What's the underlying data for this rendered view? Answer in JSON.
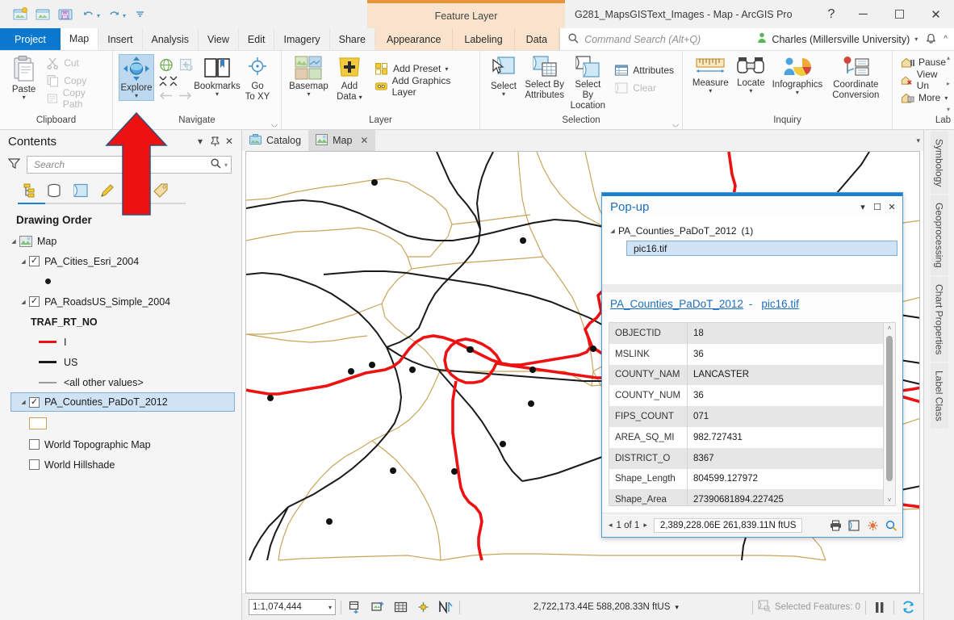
{
  "window": {
    "title": "G281_MapsGISText_Images - Map - ArcGIS Pro",
    "help_label": "?",
    "minimize_label": "─",
    "maximize_label": "☐",
    "close_label": "✕"
  },
  "quick_access": {
    "items": [
      {
        "name": "new-project-icon",
        "title": "New Project"
      },
      {
        "name": "open-project-icon",
        "title": "Open Project"
      },
      {
        "name": "save-project-icon",
        "title": "Save Project"
      },
      {
        "name": "undo-icon",
        "title": "Undo"
      },
      {
        "name": "redo-icon",
        "title": "Redo"
      },
      {
        "name": "customize-quick-access-icon",
        "title": "Customize Quick Access Toolbar"
      }
    ]
  },
  "contextual_tab_group": {
    "label": "Feature Layer"
  },
  "ribbon_tabs": [
    {
      "label": "Project",
      "kind": "project"
    },
    {
      "label": "Map",
      "kind": "active"
    },
    {
      "label": "Insert",
      "kind": "normal"
    },
    {
      "label": "Analysis",
      "kind": "normal"
    },
    {
      "label": "View",
      "kind": "normal"
    },
    {
      "label": "Edit",
      "kind": "normal"
    },
    {
      "label": "Imagery",
      "kind": "normal"
    },
    {
      "label": "Share",
      "kind": "normal"
    },
    {
      "label": "Appearance",
      "kind": "ctx"
    },
    {
      "label": "Labeling",
      "kind": "ctx"
    },
    {
      "label": "Data",
      "kind": "ctx"
    }
  ],
  "command_search": {
    "placeholder": "Command Search (Alt+Q)",
    "icon": "search-icon"
  },
  "account": {
    "name": "Charles (Millersville University)",
    "caret": "▾",
    "notification_icon": "bell-icon",
    "collapse_ribbon_icon": "chevron-up-icon"
  },
  "ribbon_groups": [
    {
      "label": "Clipboard",
      "big": [
        {
          "label": "Paste",
          "icon": "paste-icon",
          "has_caret": true
        }
      ],
      "small": [
        {
          "label": "Cut",
          "icon": "cut-icon",
          "disabled": true
        },
        {
          "label": "Copy",
          "icon": "copy-icon",
          "disabled": true
        },
        {
          "label": "Copy Path",
          "icon": "copy-path-icon",
          "disabled": true
        }
      ]
    },
    {
      "label": "Navigate",
      "has_dialog_launcher": true,
      "big": [
        {
          "label": "Explore",
          "icon": "explore-icon",
          "has_caret": true,
          "selected": true
        },
        {
          "label": "Bookmarks",
          "icon": "bookmarks-icon",
          "has_caret": true
        },
        {
          "label": "Go\nTo XY",
          "icon": "go-to-xy-icon",
          "has_caret": false
        }
      ],
      "small": [
        {
          "label": "",
          "icon": "full-extent-icon"
        },
        {
          "label": "",
          "icon": "fixed-zoom-in-icon"
        },
        {
          "label": "",
          "icon": "zoom-to-selection-icon"
        },
        {
          "label": "",
          "icon": "previous-extent-icon"
        },
        {
          "label": "",
          "icon": "next-extent-icon"
        }
      ]
    },
    {
      "label": "Layer",
      "big": [
        {
          "label": "Basemap",
          "icon": "basemap-icon",
          "has_caret": true
        },
        {
          "label": "Add\nData",
          "icon": "add-data-icon",
          "has_caret": true
        }
      ],
      "small": [
        {
          "label": "Add Preset",
          "icon": "add-preset-icon",
          "has_caret": true
        },
        {
          "label": "Add Graphics Layer",
          "icon": "add-graphics-layer-icon"
        }
      ]
    },
    {
      "label": "Selection",
      "has_dialog_launcher": true,
      "big": [
        {
          "label": "Select",
          "icon": "select-icon",
          "has_caret": true
        },
        {
          "label": "Select By\nAttributes",
          "icon": "select-by-attributes-icon"
        },
        {
          "label": "Select By\nLocation",
          "icon": "select-by-location-icon"
        }
      ],
      "small": [
        {
          "label": "Attributes",
          "icon": "attributes-icon"
        },
        {
          "label": "Clear",
          "icon": "clear-selection-icon",
          "disabled": true
        }
      ]
    },
    {
      "label": "Inquiry",
      "big": [
        {
          "label": "Measure",
          "icon": "measure-icon",
          "has_caret": true
        },
        {
          "label": "Locate",
          "icon": "locate-icon",
          "has_caret": true
        },
        {
          "label": "Infographics",
          "icon": "infographics-icon",
          "has_caret": true
        },
        {
          "label": "Coordinate\nConversion",
          "icon": "coordinate-conversion-icon"
        }
      ],
      "small": []
    },
    {
      "label": "Lab",
      "big": [],
      "small": [
        {
          "label": "Pause",
          "icon": "pause-labeling-icon"
        },
        {
          "label": "View Un",
          "icon": "view-unplaced-labels-icon"
        },
        {
          "label": "More",
          "icon": "more-labeling-icon",
          "has_caret": true
        }
      ]
    }
  ],
  "contents_pane": {
    "title": "Contents",
    "menu_icon": "chevron-down-icon",
    "pin_icon": "pin-icon",
    "close_icon": "close-icon",
    "filter_icon": "funnel-icon",
    "search": {
      "placeholder": "Search",
      "value": "",
      "icon": "search-icon",
      "dropdown": "▾"
    },
    "view_tabs": [
      {
        "name": "list-by-drawing-order-icon",
        "active": true
      },
      {
        "name": "list-by-data-source-icon",
        "active": false
      },
      {
        "name": "list-by-selection-icon",
        "active": false
      },
      {
        "name": "list-by-editing-icon",
        "active": false
      },
      {
        "name": "list-by-snapping-icon",
        "active": false
      },
      {
        "name": "list-by-labeling-icon",
        "active": false
      }
    ],
    "section_title": "Drawing Order",
    "tree": [
      {
        "type": "map",
        "label": "Map",
        "indent": 0,
        "expander": true,
        "icon": "map-icon"
      },
      {
        "type": "layer",
        "label": "PA_Cities_Esri_2004",
        "indent": 1,
        "expander": true,
        "checked": true
      },
      {
        "type": "symbol-point",
        "label": "",
        "indent": 2
      },
      {
        "type": "layer",
        "label": "PA_RoadsUS_Simple_2004",
        "indent": 1,
        "expander": true,
        "checked": true
      },
      {
        "type": "field-header",
        "label": "TRAF_RT_NO",
        "indent": 2
      },
      {
        "type": "symbol-line",
        "label": "I",
        "indent": 2,
        "color": "#ee1111",
        "width": 3
      },
      {
        "type": "symbol-line",
        "label": "US",
        "indent": 2,
        "color": "#1a1a1a",
        "width": 3
      },
      {
        "type": "symbol-line",
        "label": "<all other values>",
        "indent": 2,
        "color": "#9a9a9a",
        "width": 2
      },
      {
        "type": "layer",
        "label": "PA_Counties_PaDoT_2012",
        "indent": 1,
        "expander": true,
        "checked": true,
        "selected": true
      },
      {
        "type": "symbol-poly",
        "label": "",
        "indent": 2
      },
      {
        "type": "layer",
        "label": "World Topographic Map",
        "indent": 1,
        "expander": false,
        "checked": false
      },
      {
        "type": "layer",
        "label": "World Hillshade",
        "indent": 1,
        "expander": false,
        "checked": false
      }
    ]
  },
  "view_tabs": [
    {
      "label": "Catalog",
      "icon": "catalog-icon",
      "active": false,
      "closable": false
    },
    {
      "label": "Map",
      "icon": "map-icon",
      "active": true,
      "closable": true,
      "close_label": "✕"
    }
  ],
  "view_tabs_overflow": "▾",
  "popup": {
    "title": "Pop-up",
    "menu_label": "▾",
    "maximize_label": "☐",
    "close_label": "✕",
    "result_group": "PA_Counties_PaDoT_2012",
    "result_count": "(1)",
    "result_item": "pic16.tif",
    "subtitle_layer": "PA_Counties_PaDoT_2012",
    "subtitle_dash": "-",
    "subtitle_feature": "pic16.tif",
    "attributes": [
      {
        "field": "OBJECTID",
        "value": "18"
      },
      {
        "field": "MSLINK",
        "value": "36"
      },
      {
        "field": "COUNTY_NAM",
        "value": "LANCASTER"
      },
      {
        "field": "COUNTY_NUM",
        "value": "36"
      },
      {
        "field": "FIPS_COUNT",
        "value": "071"
      },
      {
        "field": "AREA_SQ_MI",
        "value": "982.727431"
      },
      {
        "field": "DISTRICT_O",
        "value": "8367"
      },
      {
        "field": "Shape_Length",
        "value": "804599.127972"
      },
      {
        "field": "Shape_Area",
        "value": "27390681894.227425"
      }
    ],
    "pager": {
      "prev": "◂",
      "label": "1 of 1",
      "next": "▸"
    },
    "coordinates": "2,389,228.06E 261,839.11N ftUS",
    "footer_icons": [
      {
        "name": "print-popup-icon"
      },
      {
        "name": "zoom-to-feature-icon"
      },
      {
        "name": "flash-feature-icon"
      },
      {
        "name": "pan-to-feature-icon"
      }
    ],
    "scroll_up": "˄",
    "scroll_down": "˅"
  },
  "map_status": {
    "scale": "1:1,074,444",
    "scale_caret": "▾",
    "tools": [
      {
        "name": "add-new-map-icon"
      },
      {
        "name": "layout-view-icon"
      },
      {
        "name": "table-view-icon"
      },
      {
        "name": "snapping-icon"
      },
      {
        "name": "north-arrow-icon"
      }
    ],
    "coordinates": "2,722,173.44E 588,208.33N ftUS",
    "coord_caret": "▾",
    "selected_features_label": "Selected Features: 0",
    "selected_features_icon": "selection-icon",
    "pause_drawing_icon": "pause-icon",
    "refresh_icon": "refresh-icon"
  },
  "dock_tabs": [
    {
      "label": "Symbology"
    },
    {
      "label": "Geoprocessing"
    },
    {
      "label": "Chart Properties"
    },
    {
      "label": "Label Class"
    }
  ],
  "annotation": {
    "arrow_color": "#ee1111",
    "arrow_outline": "#2f4f7a",
    "points_at": "explore-tool"
  },
  "colors": {
    "accent_blue": "#0b78d0",
    "contextual_orange": "#e8943a",
    "interstate_red": "#ee1111",
    "us_route_black": "#1a1a1a",
    "county_tan": "#c8a55b",
    "selection_blue": "#cfe3f5"
  }
}
